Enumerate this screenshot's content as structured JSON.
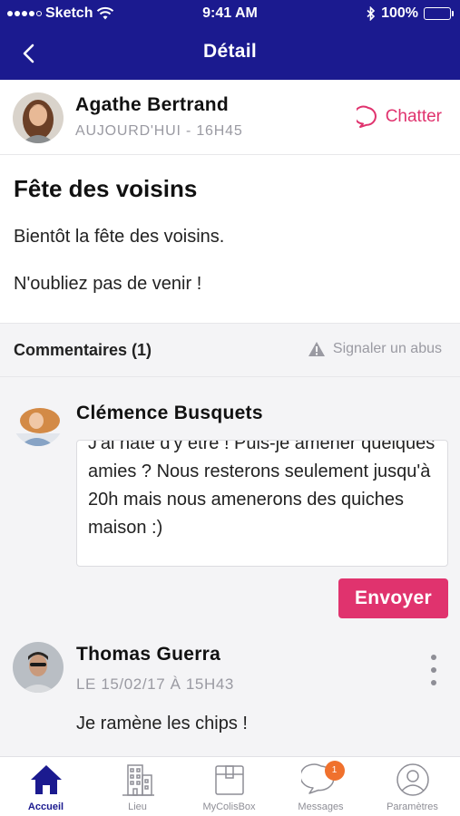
{
  "status_bar": {
    "carrier": "Sketch",
    "time": "9:41 AM",
    "battery": "100%"
  },
  "nav": {
    "title": "Détail"
  },
  "author": {
    "name": "Agathe Bertrand",
    "meta": "AUJOURD'HUI - 16H45",
    "chat_label": "Chatter"
  },
  "post": {
    "title": "Fête des voisins",
    "body_line1": "Bientôt la fête des voisins.",
    "body_line2": "N'oubliez pas de venir !"
  },
  "comments_header": {
    "label": "Commentaires (1)",
    "report_label": "Signaler un abus"
  },
  "reply": {
    "author": "Clémence Busquets",
    "text": "J'ai hâte d'y être ! Puis-je amener quelques amies ? Nous resterons seulement jusqu'à 20h mais nous amenerons des quiches maison :)",
    "send_label": "Envoyer"
  },
  "comment": {
    "author": "Thomas Guerra",
    "meta": "LE 15/02/17 À 15H43",
    "text": "Je ramène les chips !"
  },
  "tabs": [
    {
      "label": "Accueil",
      "icon": "home-icon",
      "active": true
    },
    {
      "label": "Lieu",
      "icon": "building-icon",
      "active": false
    },
    {
      "label": "MyColisBox",
      "icon": "package-icon",
      "active": false
    },
    {
      "label": "Messages",
      "icon": "chat-bubble-icon",
      "active": false,
      "badge": "1"
    },
    {
      "label": "Paramètres",
      "icon": "user-icon",
      "active": false
    }
  ],
  "colors": {
    "primary": "#1b1a8f",
    "accent": "#e0336e",
    "badge": "#f0712d"
  }
}
